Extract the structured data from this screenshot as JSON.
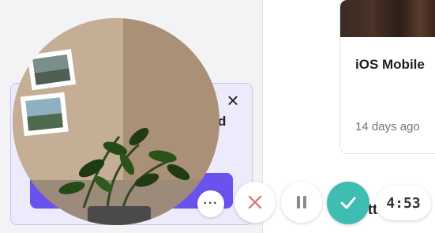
{
  "promo": {
    "partial_text": "d"
  },
  "video_card": {
    "title": "iOS Mobile",
    "age": "14 days ago"
  },
  "bottom_partial_text": "tt",
  "recorder": {
    "more_label": "···",
    "timer": "4:53",
    "colors": {
      "finish": "#3fbdb3",
      "cancel_icon": "#e07a7a",
      "pause_icon": "#8a8a8a"
    }
  },
  "icons": [
    "close-icon",
    "more-icon",
    "cancel-icon",
    "pause-icon",
    "check-icon"
  ]
}
